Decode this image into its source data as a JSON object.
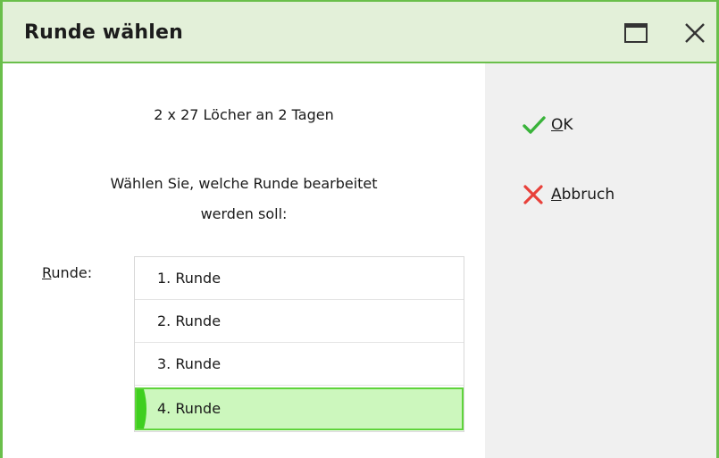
{
  "window": {
    "title": "Runde wählen",
    "accent": "#6abf4b",
    "titlebar_bg": "#e3f0d9",
    "maximize_icon": "maximize-icon",
    "close_icon": "close-icon"
  },
  "main": {
    "info": "2 x 27 Löcher an 2 Tagen",
    "prompt_line1": "Wählen Sie, welche Runde bearbeitet",
    "prompt_line2": "werden soll:",
    "runde_label_mnemonic": "R",
    "runde_label_rest": "unde:",
    "rounds": [
      {
        "label": "1. Runde",
        "selected": false
      },
      {
        "label": "2. Runde",
        "selected": false
      },
      {
        "label": "3. Runde",
        "selected": false
      },
      {
        "label": "4. Runde",
        "selected": true
      }
    ],
    "selected_bg": "#ccf7bd",
    "selected_border": "#5fd43b"
  },
  "actions": {
    "ok_mnemonic": "O",
    "ok_rest": "K",
    "ok_icon": "checkmark-icon",
    "cancel_mnemonic": "A",
    "cancel_rest": "bbruch",
    "cancel_icon": "cross-icon",
    "ok_color": "#39b33a",
    "cancel_color": "#e8403a"
  }
}
